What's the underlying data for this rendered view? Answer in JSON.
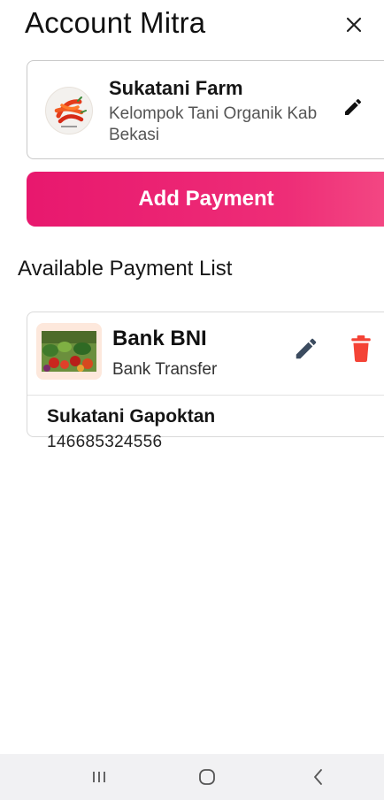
{
  "header": {
    "title": "Account Mitra",
    "close_icon": "close-icon"
  },
  "mitra": {
    "name": "Sukatani Farm",
    "description": "Kelompok Tani Organik Kab Bekasi",
    "logo_icon": "chili-logo",
    "edit_icon": "pencil-icon"
  },
  "actions": {
    "add_payment_label": "Add Payment"
  },
  "payments": {
    "section_title": "Available Payment List",
    "items": [
      {
        "bank_name": "Bank BNI",
        "type": "Bank Transfer",
        "account_name": "Sukatani Gapoktan",
        "account_number": "146685324556",
        "edit_icon": "pencil-icon",
        "delete_icon": "trash-icon"
      }
    ]
  },
  "navbar": {
    "recent_icon": "recent-apps-icon",
    "home_icon": "home-icon",
    "back_icon": "back-icon"
  },
  "colors": {
    "accent": "#e8186e",
    "delete": "#f44336",
    "edit": "#3b4b5f"
  }
}
